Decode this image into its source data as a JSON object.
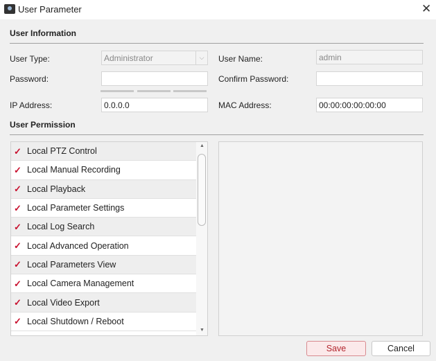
{
  "window": {
    "title": "User Parameter",
    "icon": "app-camera-icon",
    "close_icon": "close-icon"
  },
  "user_info": {
    "heading": "User Information",
    "user_type_label": "User Type:",
    "user_type_value": "Administrator",
    "user_name_label": "User Name:",
    "user_name_value": "admin",
    "password_label": "Password:",
    "password_value": "",
    "confirm_label": "Confirm Password:",
    "confirm_value": "",
    "ip_label": "IP Address:",
    "ip_value": "0.0.0.0",
    "mac_label": "MAC Address:",
    "mac_value": "00:00:00:00:00:00"
  },
  "permission": {
    "heading": "User Permission",
    "items": [
      {
        "label": "Local PTZ Control",
        "checked": true
      },
      {
        "label": "Local Manual Recording",
        "checked": true
      },
      {
        "label": "Local Playback",
        "checked": true
      },
      {
        "label": "Local Parameter Settings",
        "checked": true
      },
      {
        "label": "Local Log Search",
        "checked": true
      },
      {
        "label": "Local Advanced Operation",
        "checked": true
      },
      {
        "label": "Local Parameters View",
        "checked": true
      },
      {
        "label": "Local Camera Management",
        "checked": true
      },
      {
        "label": "Local Video Export",
        "checked": true
      },
      {
        "label": "Local Shutdown / Reboot",
        "checked": true
      }
    ]
  },
  "buttons": {
    "save": "Save",
    "cancel": "Cancel"
  },
  "colors": {
    "accent": "#c8102e",
    "save_border": "#d88a8f"
  }
}
